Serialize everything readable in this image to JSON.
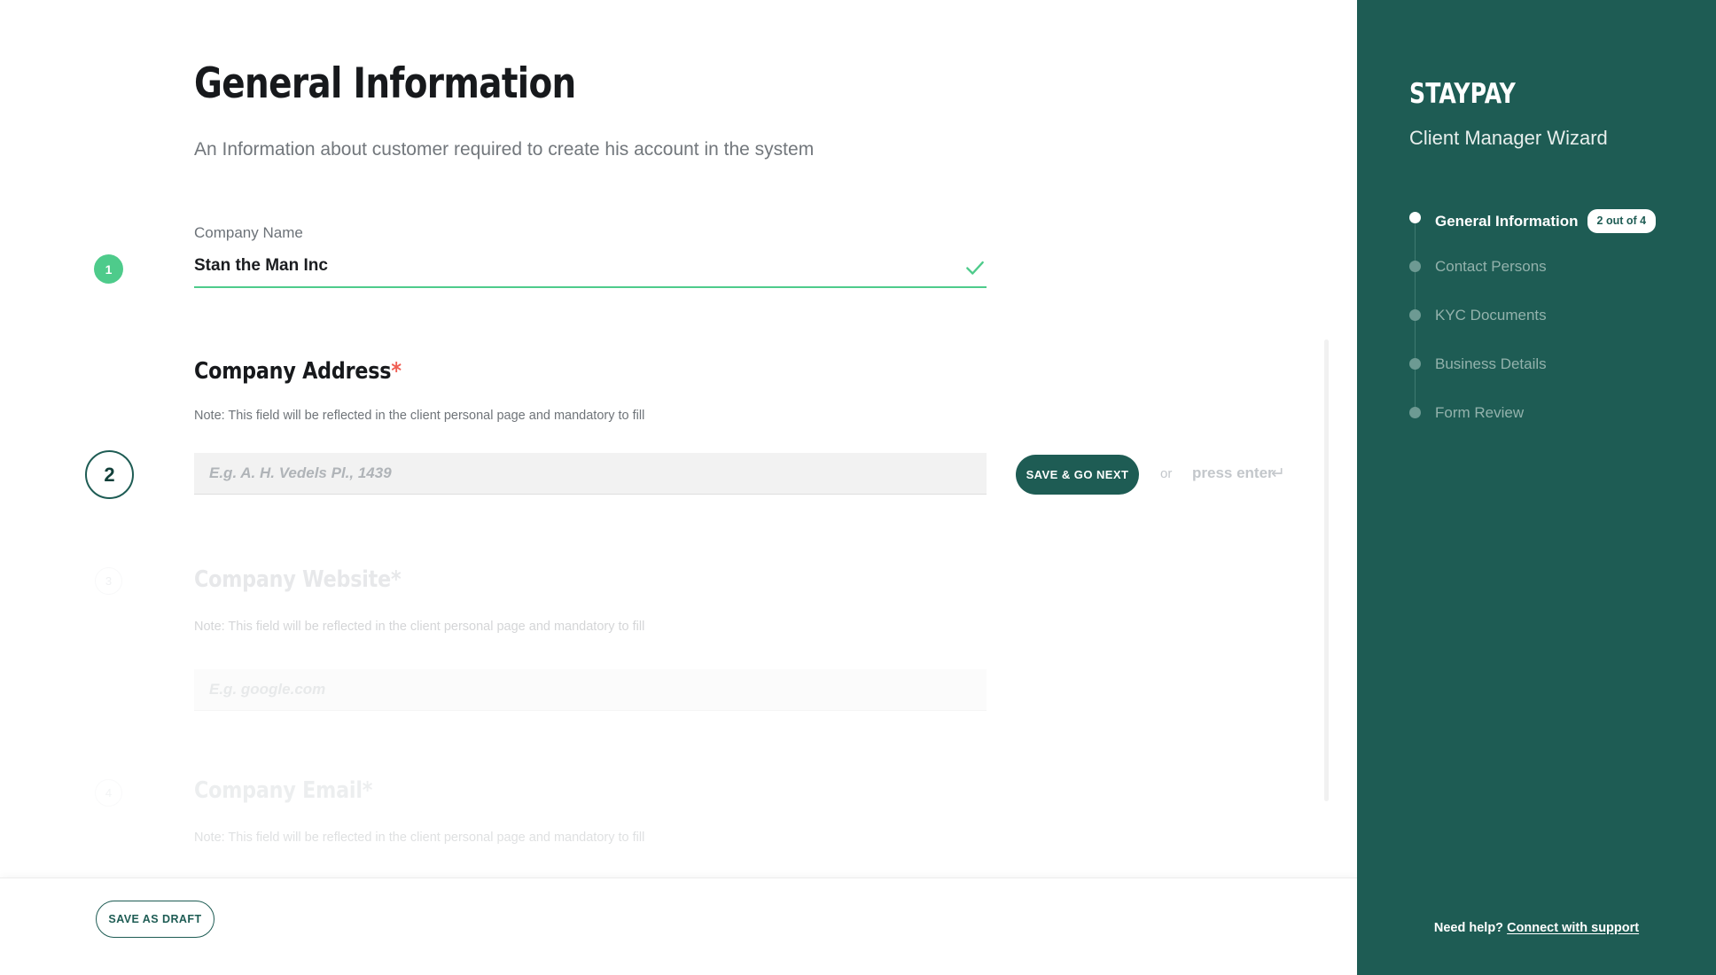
{
  "main": {
    "title": "General Information",
    "subtitle": "An Information about customer required to create his account in the system",
    "steps": {
      "one": "1",
      "two": "2",
      "three": "3",
      "four": "4"
    },
    "field_company_name": {
      "label": "Company Name",
      "value": "Stan the Man Inc",
      "status_icon": "check-icon"
    },
    "field_company_address": {
      "heading": "Company Address",
      "required_mark": "*",
      "note": "Note: This field will be reflected in the client personal page and mandatory to fill",
      "placeholder": "E.g. A. H. Vedels Pl., 1439",
      "value": ""
    },
    "field_company_website": {
      "heading": "Company Website*",
      "note": "Note: This field will be reflected in the client personal page and mandatory to fill",
      "placeholder": "E.g. google.com",
      "value": ""
    },
    "field_company_email": {
      "heading": "Company Email*",
      "note": "Note: This field will be reflected in the client personal page and mandatory to fill"
    },
    "actions": {
      "save_next": "SAVE & GO NEXT",
      "or": "or",
      "press_enter": "press enter",
      "enter_arrow": "↵",
      "save_draft": "SAVE AS DRAFT"
    }
  },
  "sidebar": {
    "brand": "STAYPAY",
    "brand_subtitle": "Client Manager Wizard",
    "steps": [
      {
        "label": "General Information",
        "counter": "2 out of 4",
        "current": true
      },
      {
        "label": "Contact Persons",
        "counter": "",
        "current": false
      },
      {
        "label": "KYC Documents",
        "counter": "",
        "current": false
      },
      {
        "label": "Business Details",
        "counter": "",
        "current": false
      },
      {
        "label": "Form Review",
        "counter": "",
        "current": false
      }
    ],
    "help_prefix": "Need help?",
    "help_link": "Connect with support"
  },
  "colors": {
    "sidebar_bg": "#1e5c54",
    "accent_green": "#4ecb8b",
    "required_red": "#f05d52",
    "input_bg": "#f2f2f2"
  }
}
